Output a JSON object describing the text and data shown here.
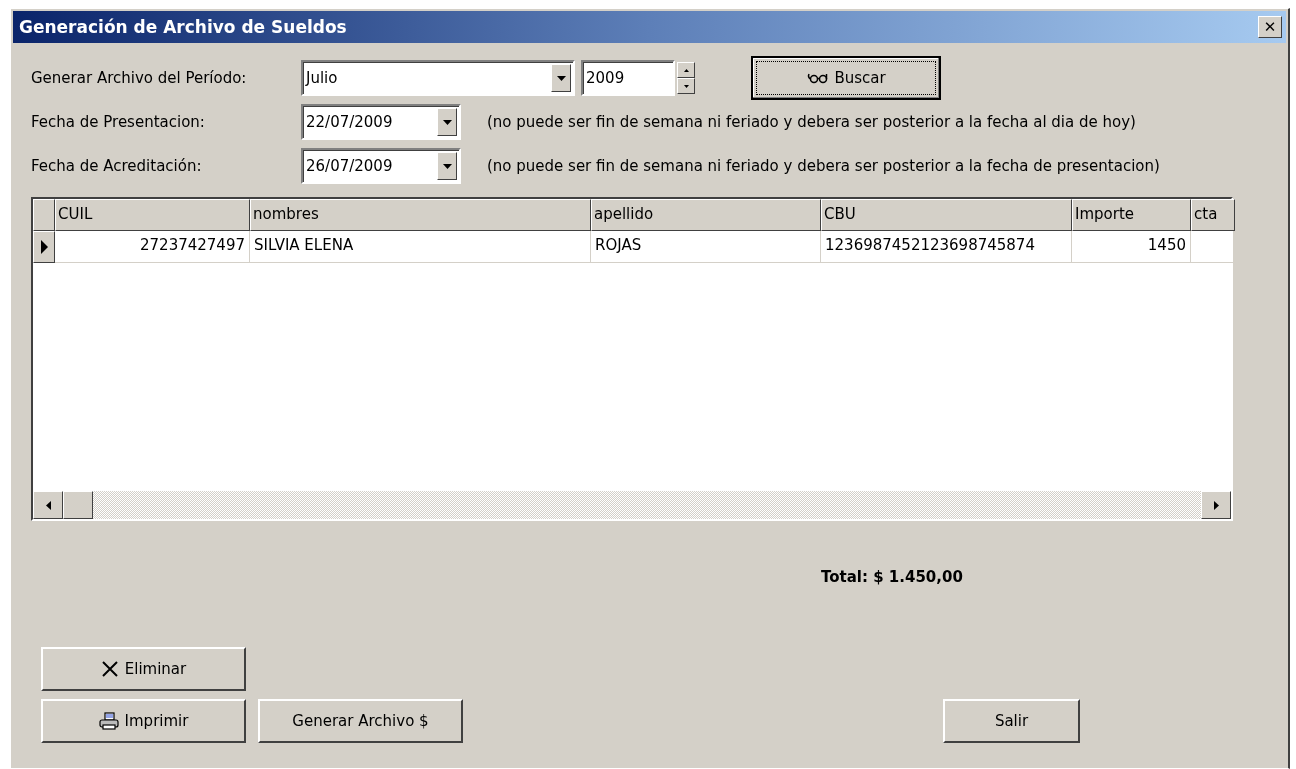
{
  "window": {
    "title": "Generación de Archivo de Sueldos",
    "close": "✕"
  },
  "period": {
    "label": "Generar Archivo del Período:",
    "month": "Julio",
    "year": "2009"
  },
  "search_button": {
    "label": "Buscar",
    "focused": true
  },
  "dates": [
    {
      "label": "Fecha de Presentacion:",
      "value": "22/07/2009",
      "hint": "(no puede ser fin de semana ni feriado y debera ser posterior a la fecha al dia de hoy)"
    },
    {
      "label": "Fecha de Acreditación:",
      "value": "26/07/2009",
      "hint": "(no puede ser fin de semana ni feriado y debera ser posterior a la fecha de presentacion)"
    }
  ],
  "table": {
    "columns": [
      {
        "label": "CUIL"
      },
      {
        "label": "nombres"
      },
      {
        "label": "apellido"
      },
      {
        "label": "CBU"
      },
      {
        "label": "Importe"
      },
      {
        "label": "cta"
      }
    ],
    "rows": [
      {
        "selected": true,
        "cells": [
          "27237427497",
          "SILVIA ELENA",
          "ROJAS",
          "1236987452123698745874",
          "1450",
          ""
        ]
      }
    ]
  },
  "total": "Total: $ 1.450,00",
  "buttons": [
    {
      "label": "Eliminar",
      "kind": "delete",
      "focused": false
    },
    {
      "label": "Imprimir",
      "kind": "print",
      "focused": false
    },
    {
      "label": "Generar Archivo $",
      "kind": "plain",
      "focused": false
    },
    {
      "label": "Salir",
      "kind": "plain",
      "focused": false
    }
  ]
}
